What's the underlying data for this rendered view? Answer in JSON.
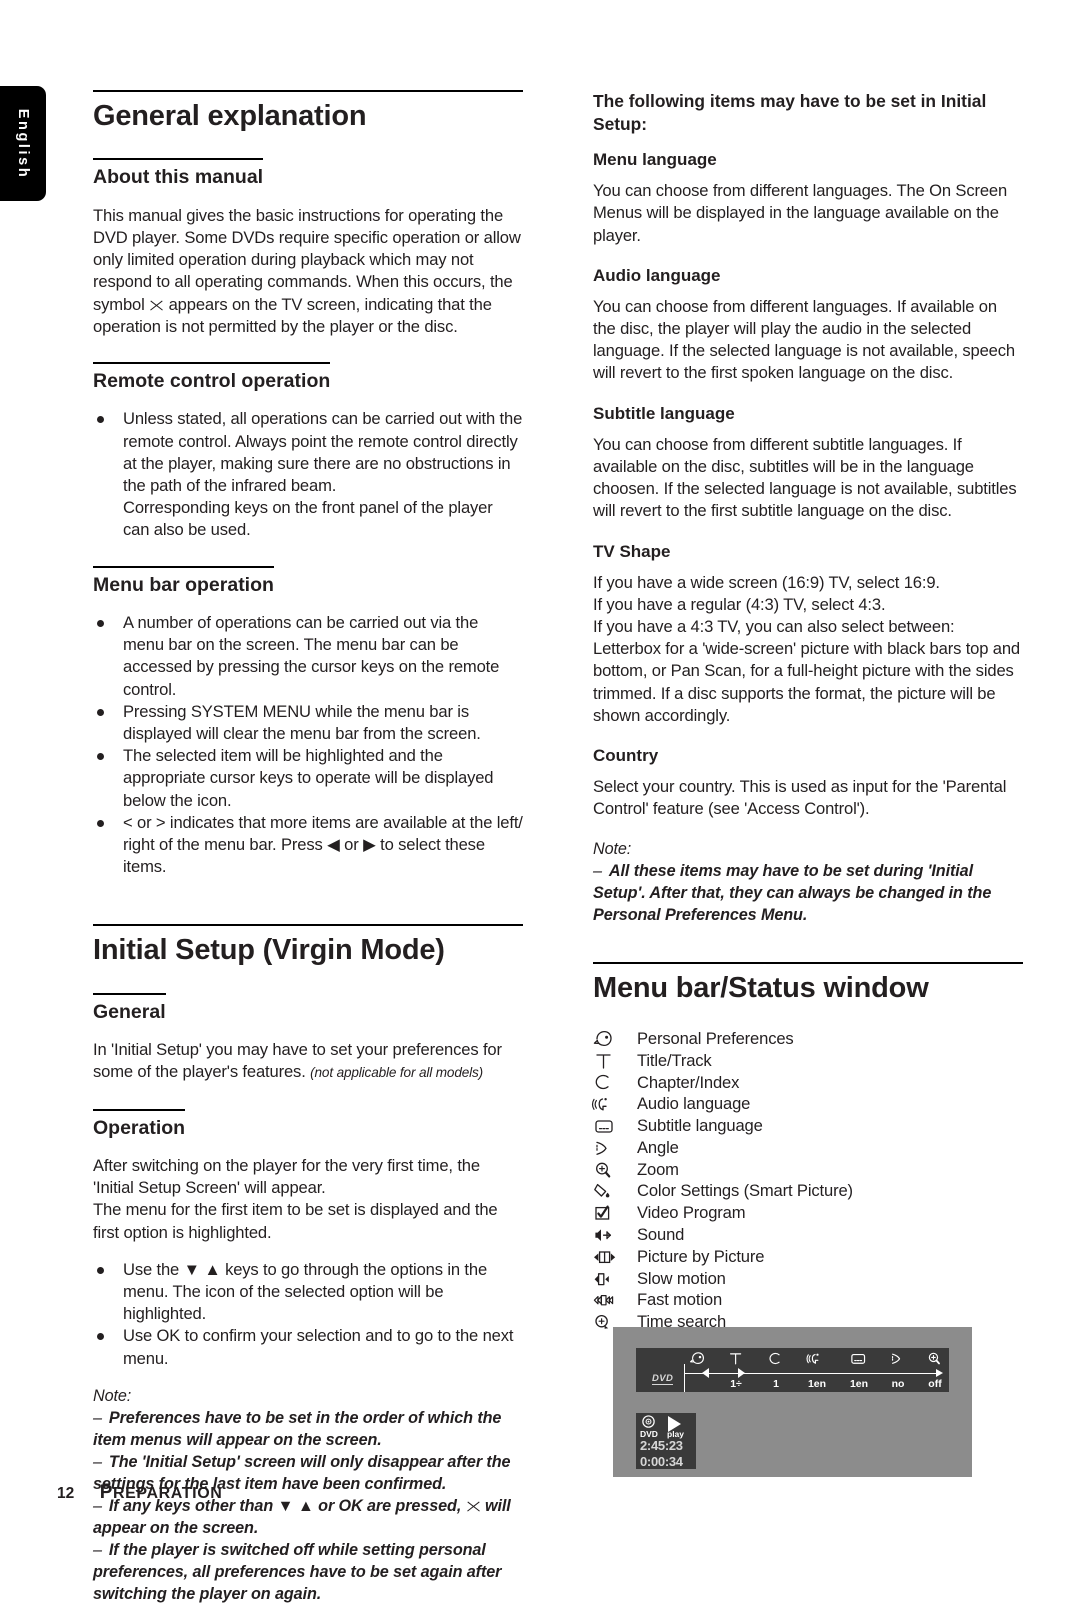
{
  "language_tab": {
    "label": "English"
  },
  "left_column": {
    "section_title": "General explanation",
    "about": {
      "heading": "About this manual",
      "paragraph_part1": "This manual gives the basic instructions for operating the DVD player. Some DVDs require specific operation or allow only limited operation during playback which may not respond to all operating commands. When this occurs, the symbol ",
      "paragraph_part2": " appears on the TV screen, indicating that the operation is not permitted by the player or the disc."
    },
    "remote": {
      "heading": "Remote control operation",
      "bullets": [
        "Unless stated, all operations can be carried out with the remote control. Always point the remote control directly at the player, making sure there are no obstructions in the path of the infrared beam.\nCorresponding keys on the front panel of the player can also be used."
      ]
    },
    "menubar": {
      "heading": "Menu bar operation",
      "bullets": [
        "A number of operations can be carried out via the menu bar on the screen. The menu bar can be accessed by pressing the cursor keys on the remote control.",
        "Pressing SYSTEM MENU while the menu bar is displayed will clear the menu bar from the screen.",
        "The selected item will be highlighted and the appropriate cursor keys to operate will be displayed below the icon.",
        "< or > indicates that more items are available at the left/ right of the menu bar. Press ◀ or ▶ to select these items."
      ]
    },
    "initial_setup": {
      "section_title": "Initial Setup (Virgin Mode)",
      "general": {
        "heading": "General",
        "paragraph": "In 'Initial Setup' you may have to set your preferences for some of the player's features. ",
        "paragraph_italic": "(not applicable for all models)"
      },
      "operation": {
        "heading": "Operation",
        "paragraph1": "After switching on the player for the very first time, the 'Initial Setup Screen' will appear.",
        "paragraph2": "The menu for the first item to be set is displayed and the first option is highlighted.",
        "bullets": [
          "Use the ▼ ▲ keys to go through the options in the menu. The icon of the selected option will be highlighted.",
          "Use OK to confirm your selection and to go to the next menu."
        ]
      },
      "note": {
        "title": "Note:",
        "items_part1": [
          "Preferences have to be set in the order of which the item menus will appear on the screen.",
          "The 'Initial Setup' screen will only disappear after the settings for the last item have been confirmed."
        ],
        "item_keys_before": "If any keys other than ▼ ▲ or OK are pressed, ",
        "item_keys_after": " will appear on the screen.",
        "items_part2": [
          "If the player is switched off while setting personal preferences, all preferences have to be set again after switching the player on again."
        ]
      }
    }
  },
  "right_column": {
    "intro_heading": "The following items may have to be set in Initial Setup:",
    "items": [
      {
        "heading": "Menu language",
        "paragraph": "You can choose from different languages. The On Screen Menus will be displayed in the language available on the player."
      },
      {
        "heading": "Audio language",
        "paragraph": "You can choose from different languages. If available on the disc, the player will play the audio in the selected language. If the selected language is not available, speech will revert to the first spoken language on the disc."
      },
      {
        "heading": "Subtitle language",
        "paragraph": "You can choose from different subtitle languages. If available on the disc, subtitles will be in the language choosen. If the selected language is not available, subtitles will revert to the first subtitle language on the disc."
      },
      {
        "heading": "TV Shape",
        "paragraph": "If you have a wide screen (16:9) TV, select 16:9.\nIf you have a regular (4:3) TV, select 4:3.\nIf you have a 4:3 TV, you can also select between:\nLetterbox for a 'wide-screen' picture with black bars top and bottom, or Pan Scan, for a full-height picture with the sides trimmed. If a disc supports the format, the picture will be shown accordingly."
      },
      {
        "heading": "Country",
        "paragraph": "Select your country. This is used as input for the 'Parental Control' feature (see 'Access Control')."
      }
    ],
    "note": {
      "title": "Note:",
      "items": [
        "All these items may have to be set during 'Initial Setup'. After that, they can always be changed in the Personal Preferences Menu."
      ]
    },
    "menu_bar_section": {
      "section_title": "Menu bar/Status window",
      "legend": [
        {
          "icon": "personal-preferences-icon",
          "label": "Personal Preferences"
        },
        {
          "icon": "title-track-icon",
          "label": "Title/Track"
        },
        {
          "icon": "chapter-index-icon",
          "label": "Chapter/Index"
        },
        {
          "icon": "audio-language-icon",
          "label": "Audio language"
        },
        {
          "icon": "subtitle-language-icon",
          "label": "Subtitle language"
        },
        {
          "icon": "angle-icon",
          "label": "Angle"
        },
        {
          "icon": "zoom-icon",
          "label": "Zoom"
        },
        {
          "icon": "color-settings-icon",
          "label": "Color Settings (Smart Picture)"
        },
        {
          "icon": "video-program-icon",
          "label": "Video Program"
        },
        {
          "icon": "sound-icon",
          "label": "Sound"
        },
        {
          "icon": "picture-by-picture-icon",
          "label": "Picture by Picture"
        },
        {
          "icon": "slow-motion-icon",
          "label": "Slow motion"
        },
        {
          "icon": "fast-motion-icon",
          "label": "Fast motion"
        },
        {
          "icon": "time-search-icon",
          "label": "Time search"
        }
      ]
    },
    "screenshot": {
      "disc_logo": "DVD",
      "menu_cells": [
        {
          "icon": "personal-preferences-icon",
          "value": ""
        },
        {
          "icon": "title-track-icon",
          "value": "1÷"
        },
        {
          "icon": "chapter-index-icon",
          "value": "1"
        },
        {
          "icon": "audio-language-icon",
          "value": "1en"
        },
        {
          "icon": "subtitle-language-icon",
          "value": "1en"
        },
        {
          "icon": "angle-icon",
          "value": "no"
        },
        {
          "icon": "zoom-icon",
          "value": "off"
        }
      ],
      "status": {
        "disc_label": "DVD",
        "play_label": "play",
        "total_time": "2:45:23",
        "elapsed_time": "0:00:34"
      }
    }
  },
  "footer": {
    "page_number": "12",
    "caption_first": "P",
    "caption_rest": "REPARATION"
  }
}
